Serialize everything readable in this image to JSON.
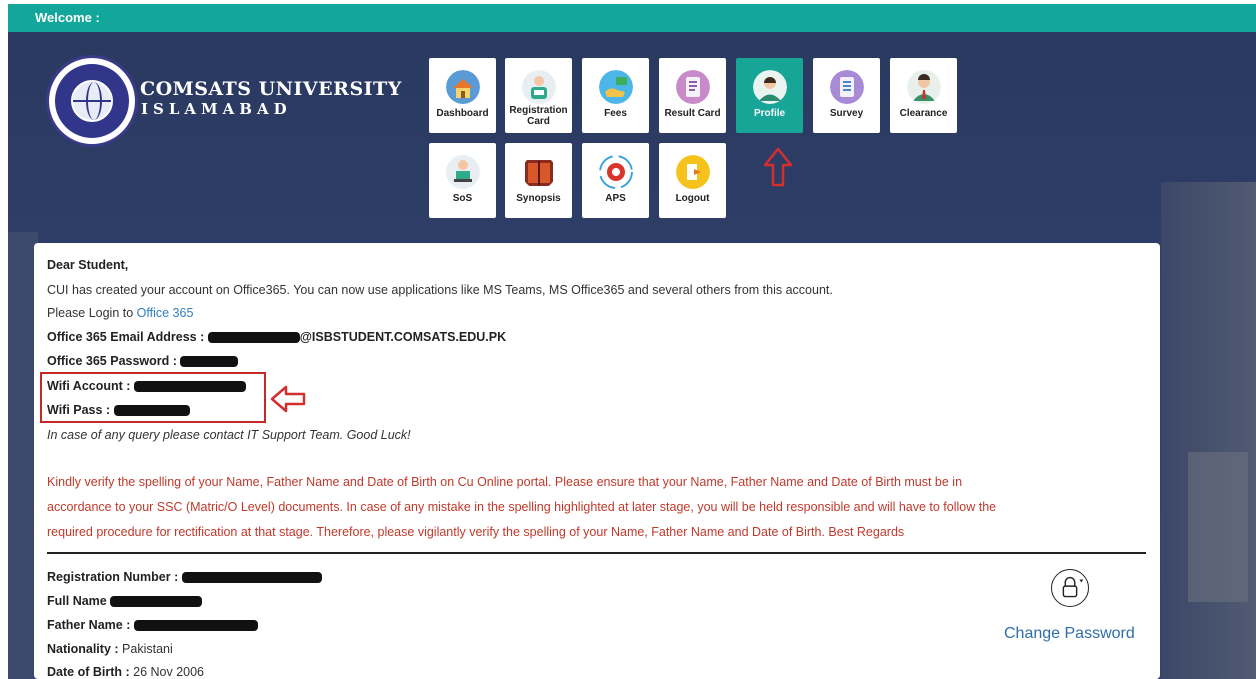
{
  "topbar": {
    "welcome": "Welcome :"
  },
  "university": {
    "name": "COMSATS UNIVERSITY",
    "city": "ISLAMABAD",
    "logo_text_top": "COMSATS UNIVERSITY",
    "logo_text_bottom": "ISLAMABAD"
  },
  "nav": {
    "tiles": [
      {
        "label": "Dashboard",
        "icon": "house-icon"
      },
      {
        "label": "Registration Card",
        "icon": "person-id-icon"
      },
      {
        "label": "Fees",
        "icon": "hand-money-icon"
      },
      {
        "label": "Result Card",
        "icon": "document-icon"
      },
      {
        "label": "Profile",
        "icon": "user-icon",
        "active": true
      },
      {
        "label": "Survey",
        "icon": "survey-icon"
      },
      {
        "label": "Clearance",
        "icon": "person-tie-icon"
      },
      {
        "label": "SoS",
        "icon": "person-laptop-icon"
      },
      {
        "label": "Synopsis",
        "icon": "book-icon"
      },
      {
        "label": "APS",
        "icon": "gear-icon"
      },
      {
        "label": "Logout",
        "icon": "logout-icon"
      }
    ]
  },
  "notice": {
    "greeting": "Dear Student,",
    "line1": "CUI has created your account on Office365. You can now use applications like MS Teams, MS Office365 and several others from this account.",
    "login_prefix": "Please Login to ",
    "login_link": "Office 365",
    "email_label": "Office 365 Email Address :",
    "email_value": "@ISBSTUDENT.COMSATS.EDU.PK",
    "password_label": "Office 365 Password :",
    "wifi_account_label": "Wifi Account :",
    "wifi_pass_label": "Wifi Pass :",
    "support": "In case of any query please contact IT Support Team. Good Luck!",
    "warning_l1": "Kindly verify the spelling of your Name, Father Name and Date of Birth on Cu Online portal. Please ensure that your Name, Father Name and Date of Birth must be in",
    "warning_l2": "accordance to your SSC (Matric/O Level) documents. In case of any mistake in the spelling highlighted at later stage, you will be held responsible and will have to follow the",
    "warning_l3": "required procedure for rectification at that stage. Therefore, please vigilantly verify the spelling of your Name, Father Name and Date of Birth. Best Regards"
  },
  "profile": {
    "reg_label": "Registration Number :",
    "name_label": "Full Name",
    "father_label": "Father Name :",
    "nationality_label": "Nationality :",
    "nationality_value": "Pakistani",
    "dob_label": "Date of Birth :",
    "dob_value": "26 Nov 2006",
    "change_password": "Change Password"
  },
  "colors": {
    "teal": "#13a69a",
    "navy": "#2d3b63",
    "red_text": "#c0392b",
    "link": "#2f7fbf"
  }
}
